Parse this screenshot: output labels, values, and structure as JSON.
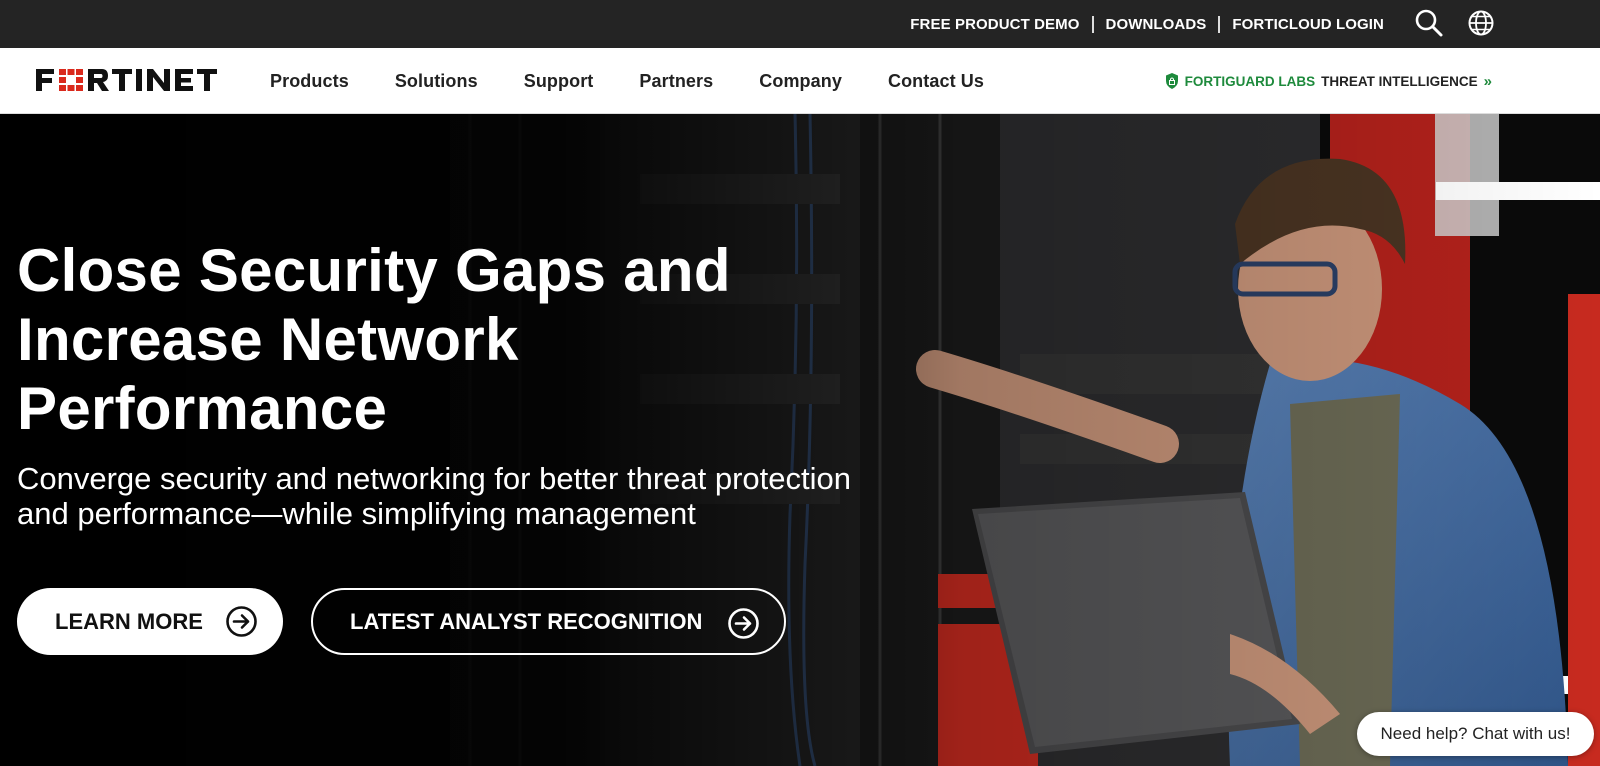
{
  "utility_bar": {
    "links": [
      "FREE PRODUCT DEMO",
      "DOWNLOADS",
      "FORTICLOUD LOGIN"
    ],
    "icons": [
      "search-icon",
      "globe-icon"
    ]
  },
  "nav": {
    "logo_text": "FORTINET",
    "items": [
      "Products",
      "Solutions",
      "Support",
      "Partners",
      "Company",
      "Contact Us"
    ],
    "fortiguard": {
      "brand": "FORTIGUARD LABS",
      "text": "THREAT INTELLIGENCE",
      "arrow": "»"
    }
  },
  "hero": {
    "title_lines": [
      "Close Security Gaps and",
      "Increase Network",
      "Performance"
    ],
    "subtitle_lines": [
      "Converge security and networking for better threat protection",
      "and performance—while simplifying management"
    ],
    "buttons": {
      "learn_more": "LEARN MORE",
      "analyst": "LATEST ANALYST RECOGNITION"
    }
  },
  "chat": {
    "label": "Need help? Chat with us!"
  },
  "colors": {
    "brand_red": "#da291c",
    "fortiguard_green": "#1e8a3c",
    "utility_bar_bg": "#242424"
  }
}
